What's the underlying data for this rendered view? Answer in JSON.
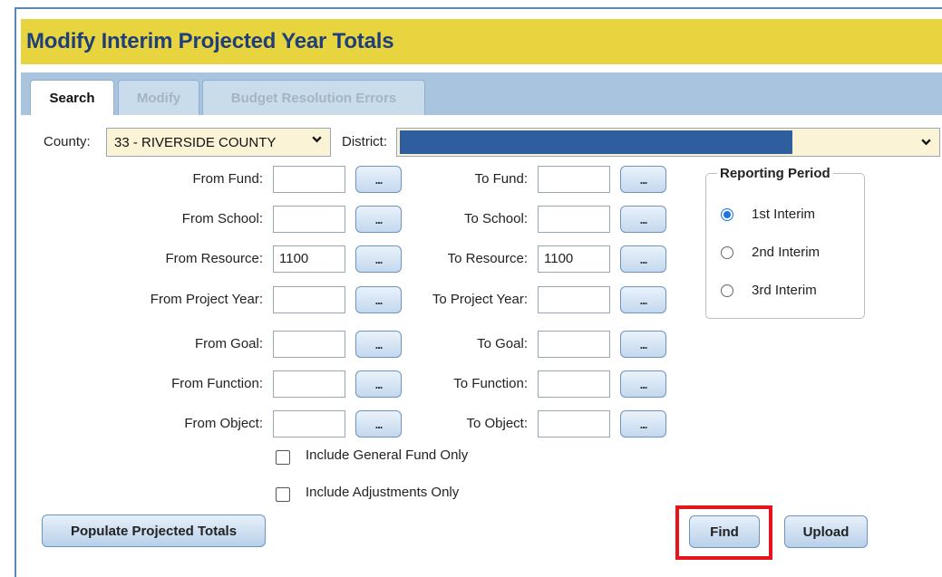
{
  "header": {
    "title": "Modify Interim Projected Year Totals"
  },
  "tabs": [
    {
      "label": "Search",
      "active": true
    },
    {
      "label": "Modify",
      "active": false
    },
    {
      "label": "Budget Resolution Errors",
      "active": false
    }
  ],
  "filters": {
    "county_label": "County:",
    "county_value": "33 - RIVERSIDE COUNTY",
    "district_label": "District:",
    "district_value": ""
  },
  "ranges": {
    "from_fund": {
      "label": "From Fund:",
      "value": ""
    },
    "to_fund": {
      "label": "To Fund:",
      "value": ""
    },
    "from_school": {
      "label": "From School:",
      "value": ""
    },
    "to_school": {
      "label": "To School:",
      "value": ""
    },
    "from_resource": {
      "label": "From Resource:",
      "value": "1100"
    },
    "to_resource": {
      "label": "To Resource:",
      "value": "1100"
    },
    "from_project_year": {
      "label": "From Project Year:",
      "value": ""
    },
    "to_project_year": {
      "label": "To Project Year:",
      "value": ""
    },
    "from_goal": {
      "label": "From Goal:",
      "value": ""
    },
    "to_goal": {
      "label": "To Goal:",
      "value": ""
    },
    "from_function": {
      "label": "From Function:",
      "value": ""
    },
    "to_function": {
      "label": "To Function:",
      "value": ""
    },
    "from_object": {
      "label": "From Object:",
      "value": ""
    },
    "to_object": {
      "label": "To Object:",
      "value": ""
    },
    "lookup_label": "..."
  },
  "options": {
    "general_fund_only": {
      "label": "Include General Fund Only",
      "checked": false
    },
    "adjustments_only": {
      "label": "Include Adjustments Only",
      "checked": false
    }
  },
  "reporting_period": {
    "legend": "Reporting Period",
    "options": [
      {
        "label": "1st Interim",
        "selected": true
      },
      {
        "label": "2nd Interim",
        "selected": false
      },
      {
        "label": "3rd Interim",
        "selected": false
      }
    ]
  },
  "actions": {
    "populate": "Populate Projected Totals",
    "find": "Find",
    "upload": "Upload"
  },
  "colors": {
    "title_bar": "#e8d43e",
    "title_text": "#1f3f7a",
    "tab_bar": "#a9c4de",
    "highlight": "#e8141b",
    "district_redaction": "#2f5e9e"
  }
}
